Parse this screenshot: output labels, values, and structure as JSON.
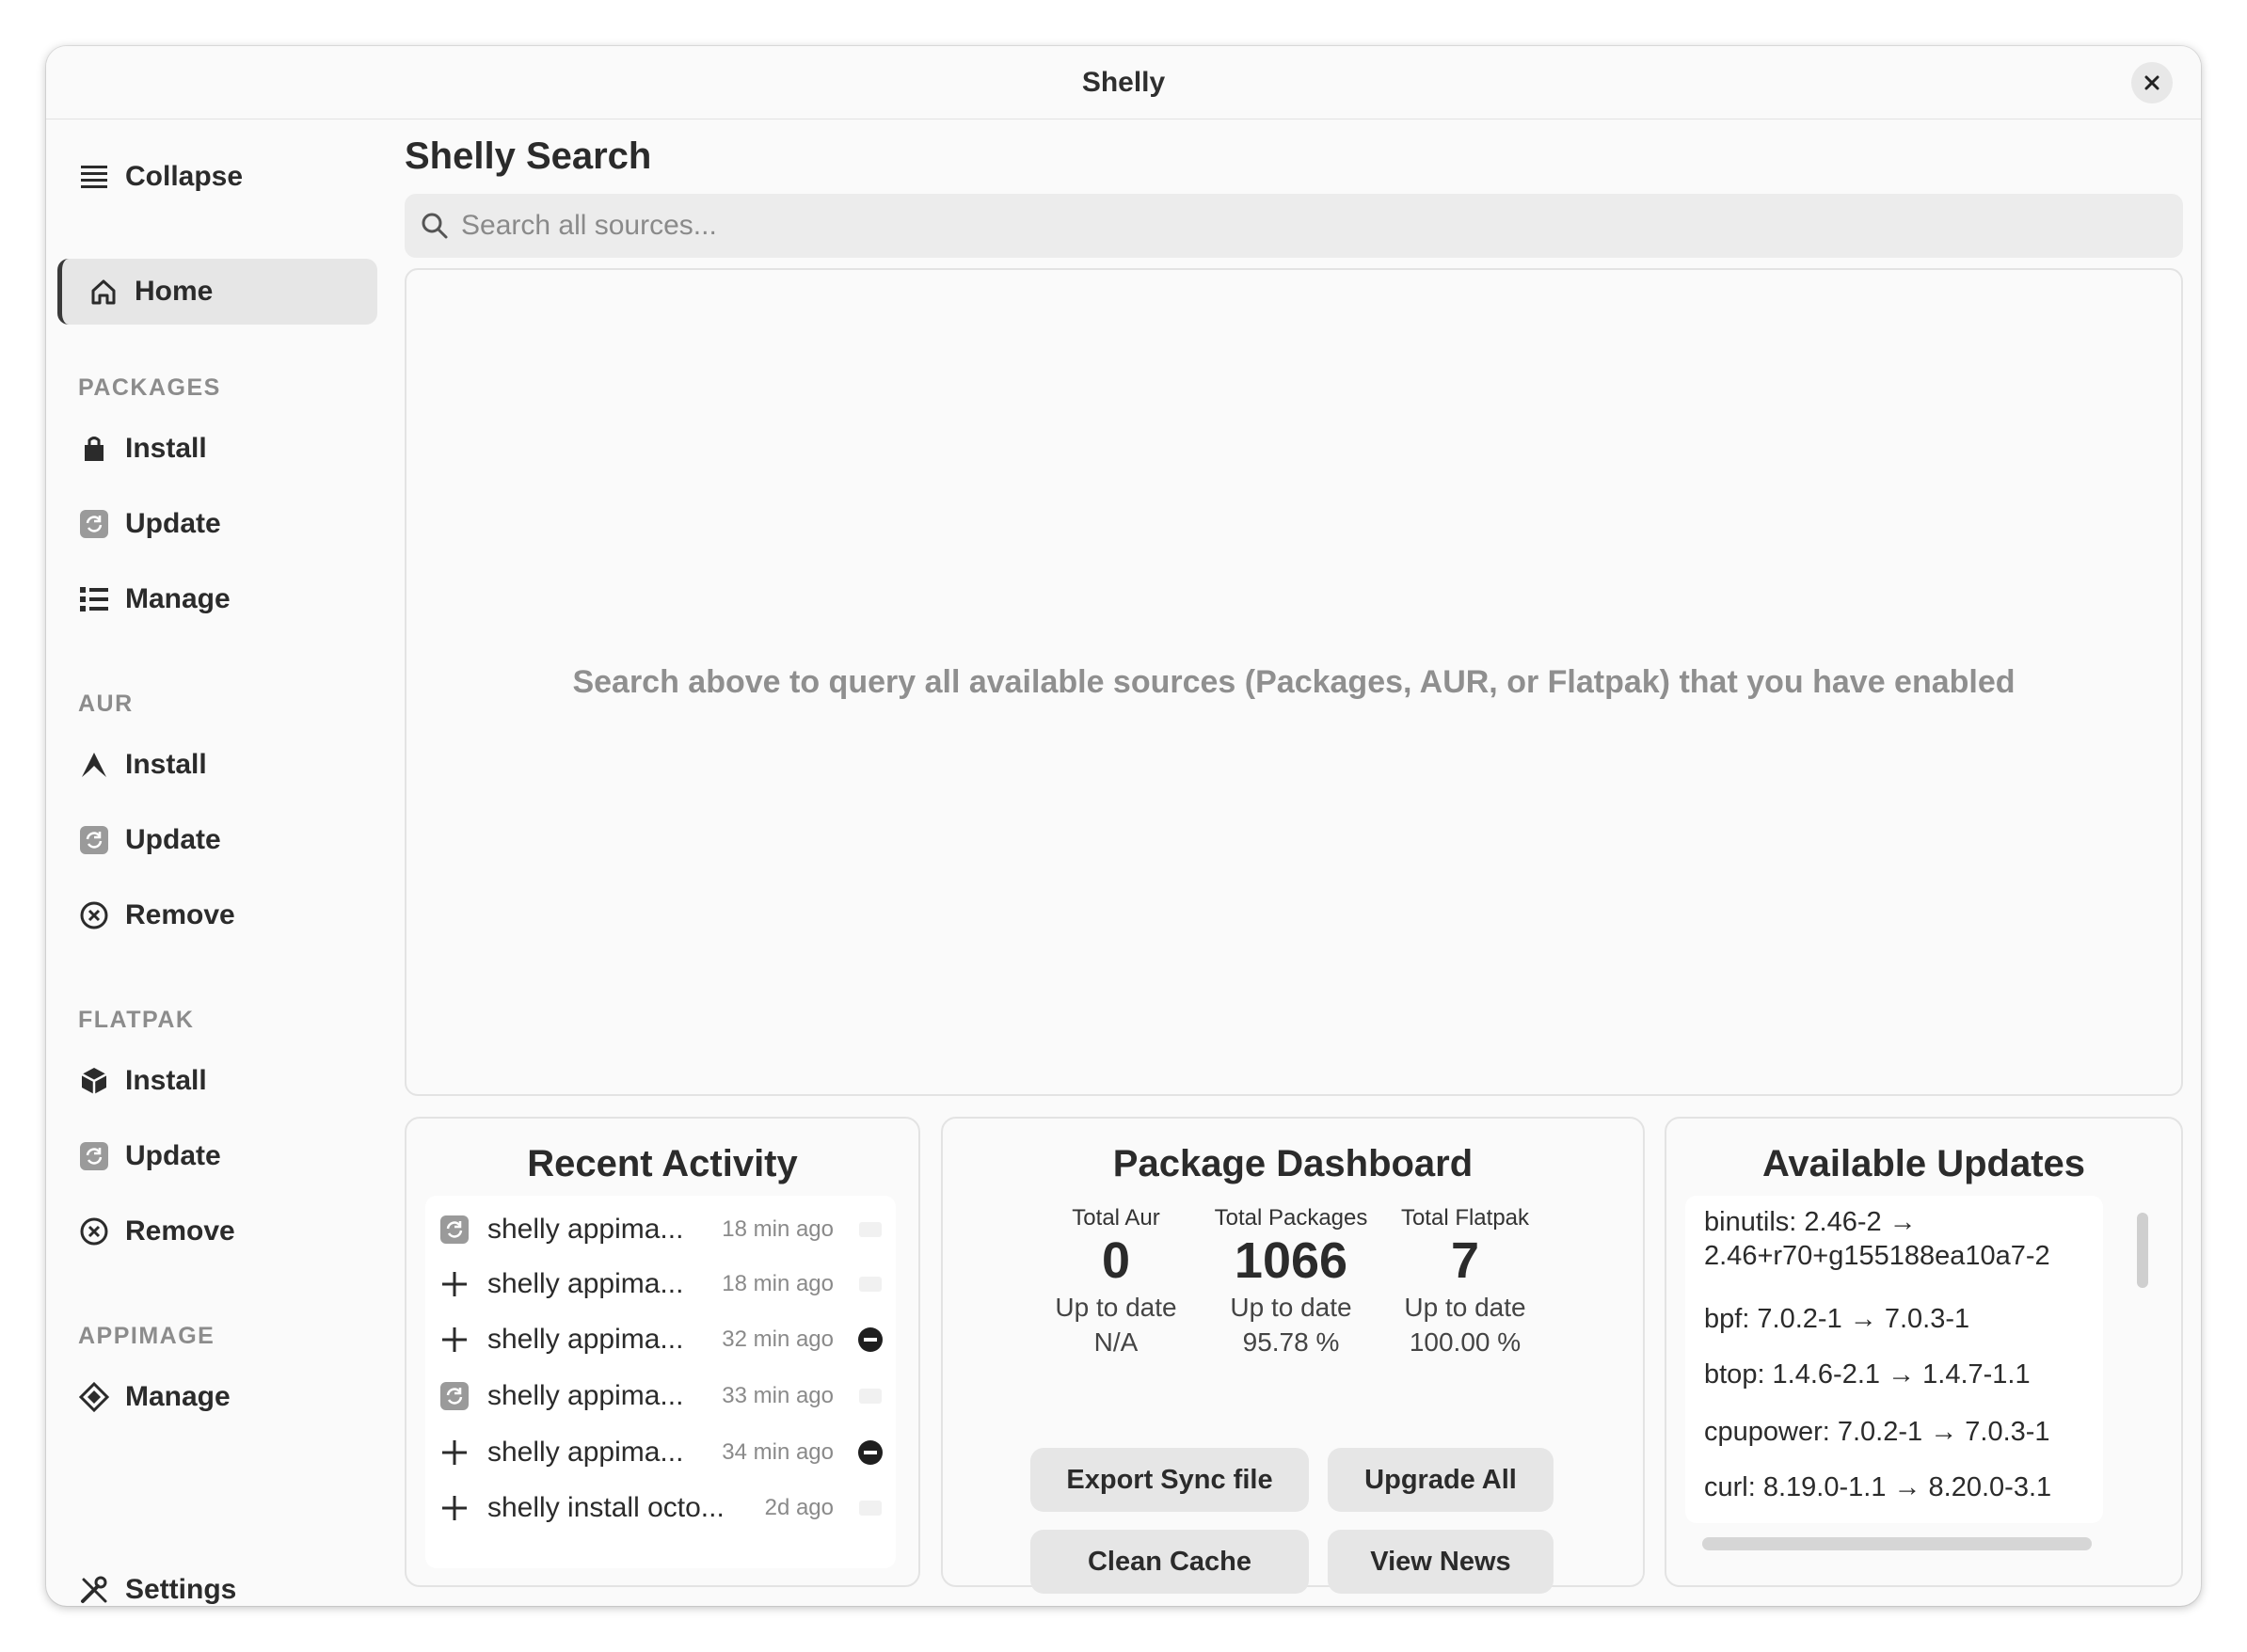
{
  "window": {
    "title": "Shelly"
  },
  "sidebar": {
    "collapse_label": "Collapse",
    "home_label": "Home",
    "sections": {
      "packages": {
        "label": "PACKAGES",
        "install": "Install",
        "update": "Update",
        "manage": "Manage"
      },
      "aur": {
        "label": "AUR",
        "install": "Install",
        "update": "Update",
        "remove": "Remove"
      },
      "flatpak": {
        "label": "FLATPAK",
        "install": "Install",
        "update": "Update",
        "remove": "Remove"
      },
      "appimage": {
        "label": "APPIMAGE",
        "manage": "Manage"
      }
    },
    "settings_label": "Settings"
  },
  "main": {
    "title": "Shelly Search",
    "search": {
      "placeholder": "Search all sources..."
    },
    "empty_message": "Search above to query all available sources (Packages, AUR, or Flatpak) that you have enabled"
  },
  "recent_activity": {
    "title": "Recent Activity",
    "items": [
      {
        "icon": "update-icon",
        "command": "shelly appima...",
        "time": "18 min ago",
        "status": "neutral"
      },
      {
        "icon": "plus-icon",
        "command": "shelly appima...",
        "time": "18 min ago",
        "status": "neutral"
      },
      {
        "icon": "plus-icon",
        "command": "shelly appima...",
        "time": "32 min ago",
        "status": "failed"
      },
      {
        "icon": "update-icon",
        "command": "shelly appima...",
        "time": "33 min ago",
        "status": "neutral"
      },
      {
        "icon": "plus-icon",
        "command": "shelly appima...",
        "time": "34 min ago",
        "status": "failed"
      },
      {
        "icon": "plus-icon",
        "command": "shelly install octo...",
        "time": "2d ago",
        "status": "neutral"
      }
    ]
  },
  "dashboard": {
    "title": "Package Dashboard",
    "stats": [
      {
        "label": "Total Aur",
        "value": "0",
        "status": "Up to date",
        "percent": "N/A"
      },
      {
        "label": "Total Packages",
        "value": "1066",
        "status": "Up to date",
        "percent": "95.78 %"
      },
      {
        "label": "Total Flatpak",
        "value": "7",
        "status": "Up to date",
        "percent": "100.00 %"
      }
    ],
    "buttons": {
      "export": "Export Sync file",
      "upgrade": "Upgrade All",
      "clean": "Clean Cache",
      "news": "View News"
    }
  },
  "updates": {
    "title": "Available Updates",
    "items": [
      {
        "line1": "binutils: 2.46-2 →",
        "line2": "2.46+r70+g155188ea10a7-2"
      },
      {
        "line1": "bpf: 7.0.2-1 → 7.0.3-1",
        "line2": ""
      },
      {
        "line1": "btop: 1.4.6-2.1 → 1.4.7-1.1",
        "line2": ""
      },
      {
        "line1": "cpupower: 7.0.2-1 → 7.0.3-1",
        "line2": ""
      },
      {
        "line1": "curl: 8.19.0-1.1 → 8.20.0-3.1",
        "line2": ""
      }
    ]
  },
  "colors": {
    "accent": "#3a3a3a",
    "failed": "#1f1f1f",
    "muted": "#8c8c8c"
  }
}
